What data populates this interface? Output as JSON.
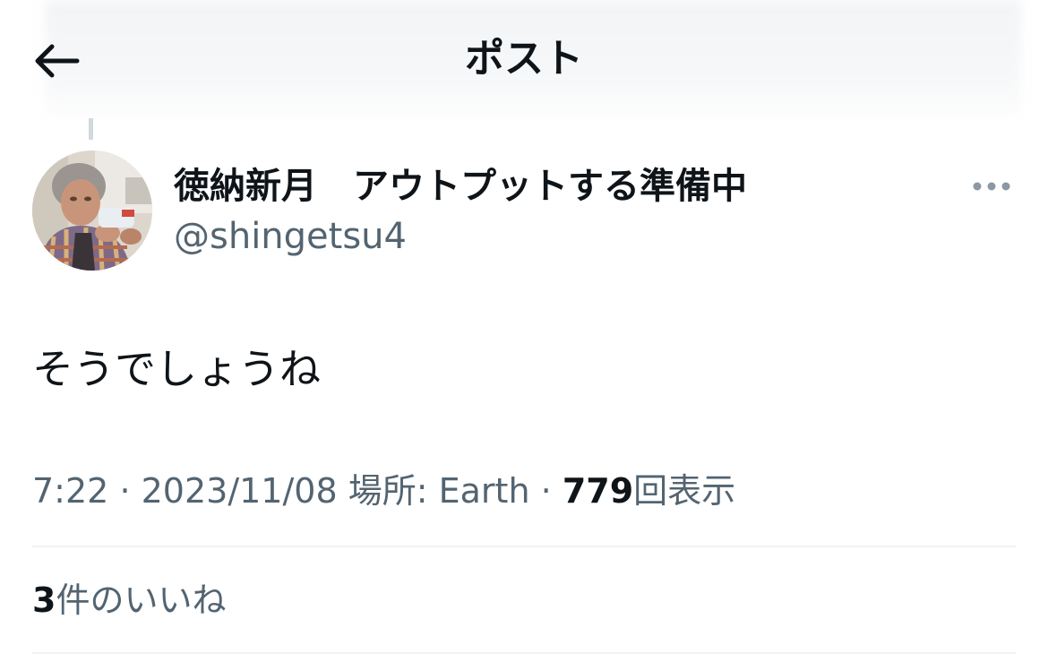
{
  "header": {
    "title": "ポスト",
    "back_icon": "arrow-left-icon"
  },
  "post": {
    "author": {
      "display_name": "徳納新月　アウトプットする準備中",
      "handle": "@shingetsu4",
      "avatar_icon": "profile-photo"
    },
    "more_icon": "more-horizontal-icon",
    "text": "そうでしょうね",
    "time": "7:22",
    "separator": "·",
    "date": "2023/11/08",
    "location_label": "場所: Earth",
    "views_count": "779",
    "views_label": "回表示",
    "likes_count": "3",
    "likes_label": "件のいいね"
  },
  "colors": {
    "text_primary": "#0f1419",
    "text_secondary": "#536471",
    "divider": "#eff3f4",
    "thread_line": "#cfd9de"
  }
}
